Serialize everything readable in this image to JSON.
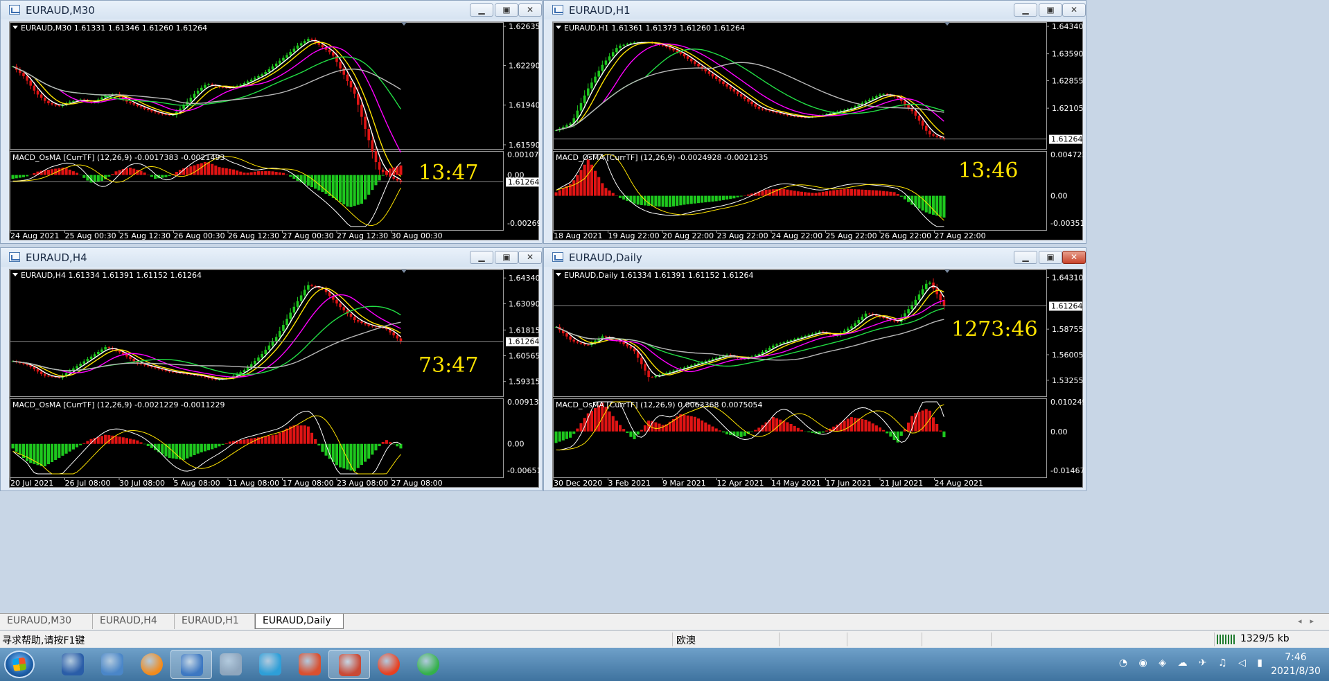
{
  "windows": [
    {
      "id": "m30",
      "title": "EURAUD,M30",
      "info": "EURAUD,M30  1.61331 1.61346 1.61260 1.61264",
      "price_ticks": [
        "1.62635",
        "1.62290",
        "1.61940",
        "1.61590"
      ],
      "current_price": "1.61264",
      "countdown": "13:47",
      "macd_label": "MACD_OsMA [CurrTF] (12,26,9) -0.0017383 -0.0021493",
      "macd_ticks": [
        "0.0010707",
        "0.00",
        "-0.0026948"
      ],
      "time_ticks": [
        "24 Aug 2021",
        "25 Aug 00:30",
        "25 Aug 12:30",
        "26 Aug 00:30",
        "26 Aug 12:30",
        "27 Aug 00:30",
        "27 Aug 12:30",
        "30 Aug 00:30"
      ],
      "buttons": {
        "minimize": "▁",
        "restore": "▣",
        "close": "✕"
      },
      "chart_data": {
        "type": "line",
        "title": "EURAUD,M30",
        "price_axis": [
          1.6159,
          1.62635
        ],
        "price": [
          1.6228,
          1.6219,
          1.6205,
          1.6196,
          1.6193,
          1.6197,
          1.6199,
          1.6196,
          1.6202,
          1.6204,
          1.6197,
          1.6193,
          1.6189,
          1.6186,
          1.6185,
          1.6194,
          1.6205,
          1.6213,
          1.621,
          1.6209,
          1.6212,
          1.6217,
          1.6222,
          1.623,
          1.6238,
          1.6247,
          1.6253,
          1.6246,
          1.6239,
          1.6221,
          1.6203,
          1.6169,
          1.6138,
          1.6131,
          1.6126
        ],
        "macd_axis": [
          -0.0026948,
          0.0010707
        ],
        "macd_hist": [
          -0.0002,
          -0.0001,
          0.0002,
          0.0003,
          0.0004,
          0.0001,
          -0.0004,
          -0.0003,
          0.0002,
          0.0004,
          0.0002,
          -0.0002,
          -0.0001,
          0.0003,
          0.0005,
          0.0007,
          0.0004,
          0.0003,
          0.0001,
          0.0002,
          0.0002,
          0.0001,
          -0.0003,
          -0.0006,
          -0.0009,
          -0.0013,
          -0.0017,
          -0.0015,
          -0.0006,
          0.0003,
          0.0005
        ]
      }
    },
    {
      "id": "h1",
      "title": "EURAUD,H1",
      "info": "EURAUD,H1  1.61361 1.61373 1.61260 1.61264",
      "price_ticks": [
        "1.64340",
        "1.63590",
        "1.62855",
        "1.62105"
      ],
      "current_price": "1.61264",
      "countdown": "13:46",
      "macd_label": "MACD_OsMA [CurrTF] (12,26,9) -0.0024928 -0.0021235",
      "macd_ticks": [
        "0.004723",
        "0.00",
        "-0.0035189"
      ],
      "time_ticks": [
        "18 Aug 2021",
        "19 Aug 22:00",
        "20 Aug 22:00",
        "23 Aug 22:00",
        "24 Aug 22:00",
        "25 Aug 22:00",
        "26 Aug 22:00",
        "27 Aug 22:00"
      ],
      "buttons": {
        "minimize": "▁",
        "restore": "▣",
        "close": "✕"
      },
      "chart_data": {
        "type": "line",
        "title": "EURAUD,H1",
        "price_axis": [
          1.61105,
          1.6434
        ],
        "price": [
          1.615,
          1.617,
          1.626,
          1.633,
          1.638,
          1.639,
          1.639,
          1.638,
          1.636,
          1.633,
          1.63,
          1.627,
          1.624,
          1.621,
          1.62,
          1.619,
          1.6185,
          1.619,
          1.62,
          1.621,
          1.623,
          1.625,
          1.624,
          1.62,
          1.614,
          1.6126
        ],
        "macd_axis": [
          -0.0035189,
          0.004723
        ],
        "macd_hist": [
          0.0004,
          0.0015,
          0.0042,
          0.001,
          -0.0003,
          -0.001,
          -0.0012,
          -0.0013,
          -0.001,
          -0.0008,
          -0.0006,
          -0.0003,
          0.0002,
          0.0007,
          0.0008,
          0.0005,
          0.0003,
          0.0006,
          0.0008,
          0.0007,
          0.0006,
          0.0004,
          -0.001,
          -0.002,
          -0.0025
        ]
      }
    },
    {
      "id": "h4",
      "title": "EURAUD,H4",
      "info": "EURAUD,H4  1.61334 1.61391 1.61152 1.61264",
      "price_ticks": [
        "1.64340",
        "1.63090",
        "1.61815",
        "1.60565",
        "1.59315"
      ],
      "current_price": "1.61264",
      "countdown": "73:47",
      "macd_label": "MACD_OsMA [CurrTF] (12,26,9) -0.0021229 -0.0011229",
      "macd_ticks": [
        "0.0091321",
        "0.00",
        "-0.0065101"
      ],
      "time_ticks": [
        "20 Jul 2021",
        "26 Jul 08:00",
        "30 Jul 08:00",
        "5 Aug 08:00",
        "11 Aug 08:00",
        "17 Aug 08:00",
        "23 Aug 08:00",
        "27 Aug 08:00"
      ],
      "buttons": {
        "minimize": "▁",
        "restore": "▣",
        "close": "✕"
      },
      "chart_data": {
        "type": "line",
        "title": "EURAUD,H4",
        "price_axis": [
          1.588,
          1.6455
        ],
        "price": [
          1.603,
          1.601,
          1.596,
          1.595,
          1.6,
          1.605,
          1.61,
          1.607,
          1.602,
          1.6,
          1.598,
          1.597,
          1.596,
          1.594,
          1.595,
          1.599,
          1.606,
          1.615,
          1.628,
          1.64,
          1.638,
          1.63,
          1.623,
          1.62,
          1.619,
          1.6126
        ],
        "macd_axis": [
          -0.0065101,
          0.0091321
        ],
        "macd_hist": [
          -0.001,
          -0.004,
          -0.005,
          -0.003,
          -0.001,
          0.001,
          0.002,
          0.0015,
          0.0008,
          -0.001,
          -0.003,
          -0.0035,
          -0.002,
          -0.001,
          0.0005,
          0.001,
          0.0015,
          0.002,
          0.004,
          0.004,
          -0.002,
          -0.005,
          -0.006,
          -0.003,
          0.001,
          -0.001
        ]
      }
    },
    {
      "id": "daily",
      "title": "EURAUD,Daily",
      "info": "EURAUD,Daily  1.61334 1.61391 1.61152 1.61264",
      "price_ticks": [
        "1.64310",
        "1.58755",
        "1.56005",
        "1.53255"
      ],
      "current_price": "1.61264",
      "countdown": "1273:46",
      "macd_label": "MACD_OsMA [CurrTF] (12,26,9) 0.0063368 0.0075054",
      "macd_ticks": [
        "0.0102498",
        "0.00",
        "-0.0146776"
      ],
      "time_ticks": [
        "30 Dec 2020",
        "3 Feb 2021",
        "9 Mar 2021",
        "12 Apr 2021",
        "14 May 2021",
        "17 Jun 2021",
        "21 Jul 2021",
        "24 Aug 2021"
      ],
      "buttons": {
        "minimize": "▁",
        "restore": "▣",
        "close": "✕"
      },
      "chart_data": {
        "type": "line",
        "title": "EURAUD,Daily",
        "price_axis": [
          1.5198,
          1.6473
        ],
        "price": [
          1.59,
          1.575,
          1.57,
          1.58,
          1.575,
          1.565,
          1.535,
          1.54,
          1.545,
          1.55,
          1.555,
          1.56,
          1.555,
          1.56,
          1.57,
          1.575,
          1.58,
          1.585,
          1.58,
          1.59,
          1.605,
          1.6,
          1.595,
          1.615,
          1.64,
          1.6126
        ],
        "macd_axis": [
          -0.0146776,
          0.0102498
        ],
        "macd_hist": [
          -0.004,
          -0.002,
          0.006,
          0.01,
          0.003,
          -0.003,
          0.004,
          0.002,
          0.006,
          0.005,
          0.002,
          -0.001,
          -0.002,
          0.001,
          0.005,
          0.003,
          0.0,
          -0.001,
          0.002,
          0.005,
          0.004,
          0.001,
          -0.004,
          0.006,
          0.008,
          -0.002
        ]
      }
    }
  ],
  "tabs": [
    "EURAUD,M30",
    "EURAUD,H4",
    "EURAUD,H1",
    "EURAUD,Daily"
  ],
  "active_tab": "EURAUD,Daily",
  "status": {
    "help": "寻求帮助,请按F1键",
    "profile": "欧澳",
    "traffic": "1329/5 kb"
  },
  "taskbar": {
    "apps": [
      "metaquotes-icon",
      "contacts-icon",
      "firefox-icon",
      "metatrader-icon",
      "camera-icon",
      "notepad-icon",
      "terminal-icon",
      "terminal2-icon",
      "bandit-icon",
      "wechat-icon"
    ],
    "time": "7:46",
    "date": "2021/8/30"
  },
  "colors": {
    "bull": "#1ec81e",
    "bear": "#e01414",
    "ma_fast": "#ffffff",
    "ma_yellow": "#ffe400",
    "ma_magenta": "#ff00ff",
    "ma_green": "#22dd44",
    "ma_gray": "#b8b8b8",
    "countdown": "#ffe400"
  }
}
